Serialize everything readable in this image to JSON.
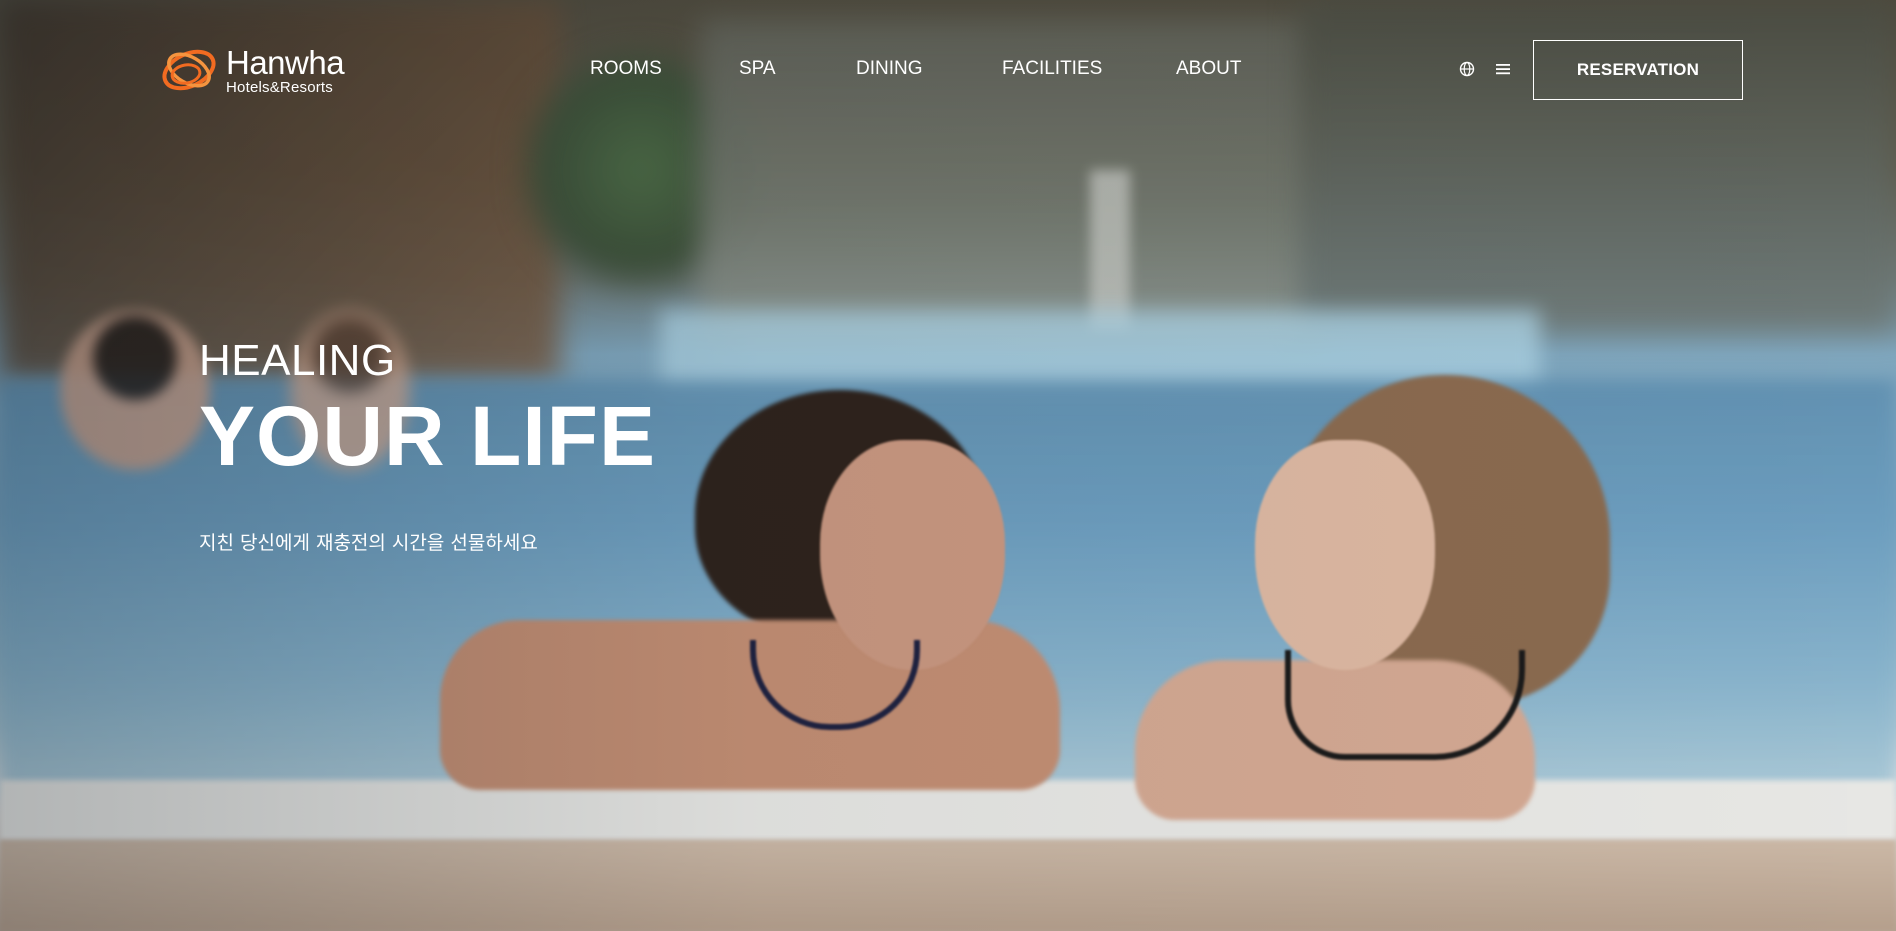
{
  "header": {
    "logo": {
      "name": "Hanwha",
      "sub": "Hotels&Resorts"
    },
    "nav": [
      {
        "label": "ROOMS"
      },
      {
        "label": "SPA"
      },
      {
        "label": "DINING"
      },
      {
        "label": "FACILITIES"
      },
      {
        "label": "ABOUT"
      }
    ],
    "icons": {
      "language": "globe-icon",
      "menu": "hamburger-menu-icon"
    },
    "reservation_label": "RESERVATION"
  },
  "hero": {
    "kicker": "HEALING",
    "title": "YOUR LIFE",
    "subtitle": "지친 당신에게 재충전의 시간을 선물하세요"
  },
  "colors": {
    "brand_orange": "#f26b21",
    "text": "#ffffff"
  }
}
